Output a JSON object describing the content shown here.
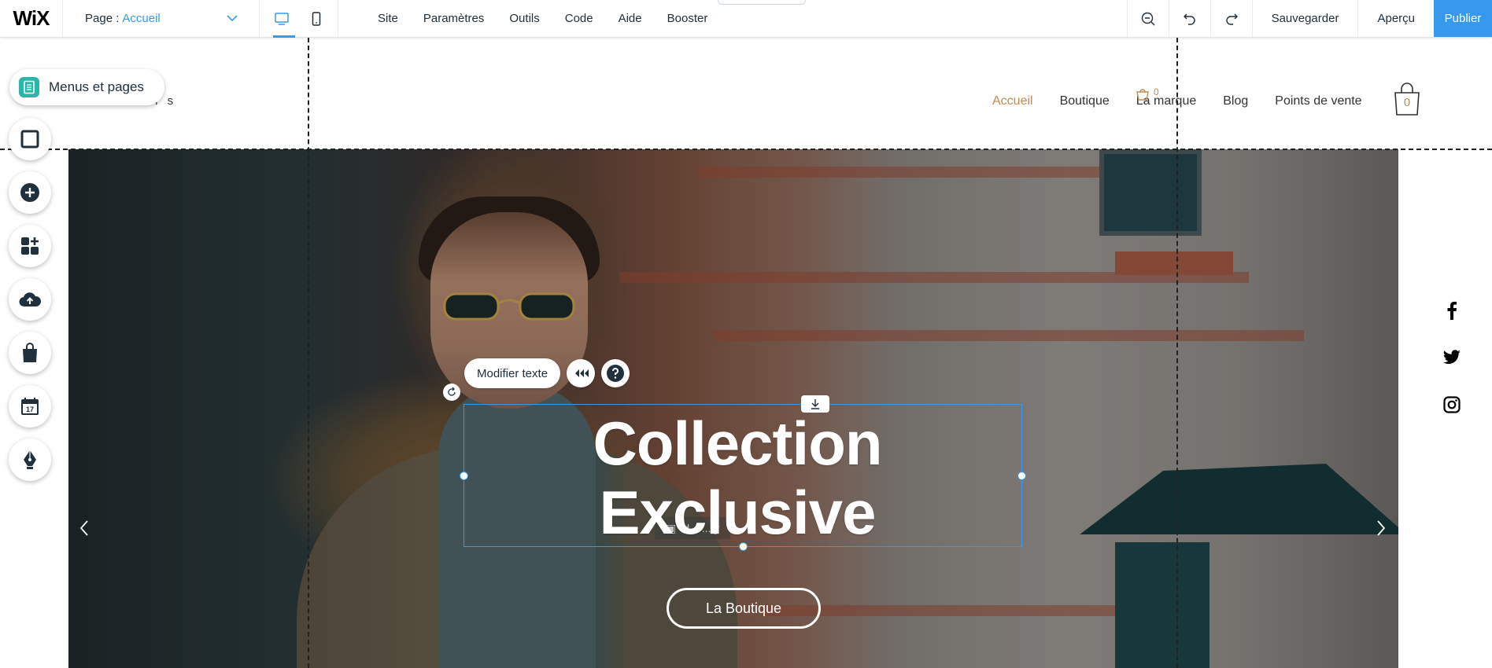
{
  "editor": {
    "logo": "WiX",
    "page_prefix": "Page :",
    "page_name": "Accueil",
    "menu": [
      "Site",
      "Paramètres",
      "Outils",
      "Code",
      "Aide",
      "Booster"
    ],
    "save_label": "Sauvegarder",
    "preview_label": "Aperçu",
    "publish_label": "Publier",
    "accent_color": "#3899ec"
  },
  "left_toolbar": {
    "menus_pages_label": "Menus et pages",
    "tools": [
      "background-icon",
      "add-icon",
      "apps-icon",
      "upload-icon",
      "store-icon",
      "bookings-icon",
      "blog-icon"
    ]
  },
  "site": {
    "brand_fragment": "r i s",
    "nav": [
      "Accueil",
      "Boutique",
      "La marque",
      "Blog",
      "Points de vente"
    ],
    "nav_active": "Accueil",
    "cart_count_small": "0",
    "cart_count": "0",
    "accent_color": "#c18b52"
  },
  "hero": {
    "title_line1": "Collection",
    "title_line2": "Exclusive",
    "cta_label": "La Boutique",
    "ghost_text": "id... ...ty"
  },
  "selection": {
    "edit_text_label": "Modifier texte"
  },
  "social": [
    "facebook-icon",
    "twitter-icon",
    "instagram-icon"
  ]
}
